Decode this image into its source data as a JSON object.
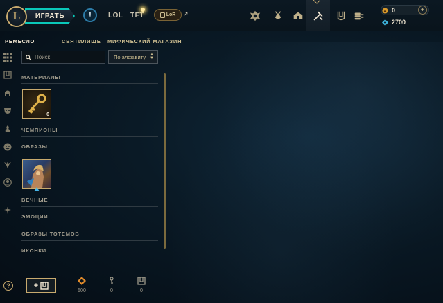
{
  "colors": {
    "gold": "#c8aa6e",
    "teal": "#0ac8b9",
    "bg": "#0a1a26"
  },
  "topbar": {
    "logo_text": "L",
    "play_label": "ИГРАТЬ",
    "alert_label": "!",
    "nav_lol": "LOL",
    "nav_tft": "TFT",
    "lor_label": "LoR",
    "lor_arrow": "↗",
    "icons": [
      "clash-icon",
      "challenges-icon",
      "collection-icon",
      "loot-icon",
      "store-icon",
      "currency-stack-icon"
    ],
    "active_icon": "loot-icon",
    "rp_value": "0",
    "be_value": "2700",
    "add_label": "+"
  },
  "subnav": {
    "tabs": [
      "РЕМЕСЛО",
      "СВЯТИЛИЩЕ",
      "МИФИЧЕСКИЙ МАГАЗИН"
    ],
    "active": 0
  },
  "filters": {
    "rail_icons": [
      "all-icon",
      "chest-icon",
      "champion-icon",
      "skin-mask-icon",
      "ward-icon",
      "emote-icon",
      "totem-icon",
      "icon-icon",
      "other-icon"
    ],
    "search_placeholder": "Поиск",
    "sort_label": "По алфавиту"
  },
  "inventory": {
    "sections": [
      "МАТЕРИАЛЫ",
      "ЧЕМПИОНЫ",
      "ОБРАЗЫ",
      "ВЕЧНЫЕ",
      "ЭМОЦИИ",
      "ОБРАЗЫ ТОТЕМОВ",
      "ИКОНКИ"
    ],
    "materials_key_count": "6"
  },
  "bottom": {
    "help_label": "?",
    "add_label": "+",
    "orange_essence": "500",
    "key_fragments": "0",
    "chests": "0"
  }
}
